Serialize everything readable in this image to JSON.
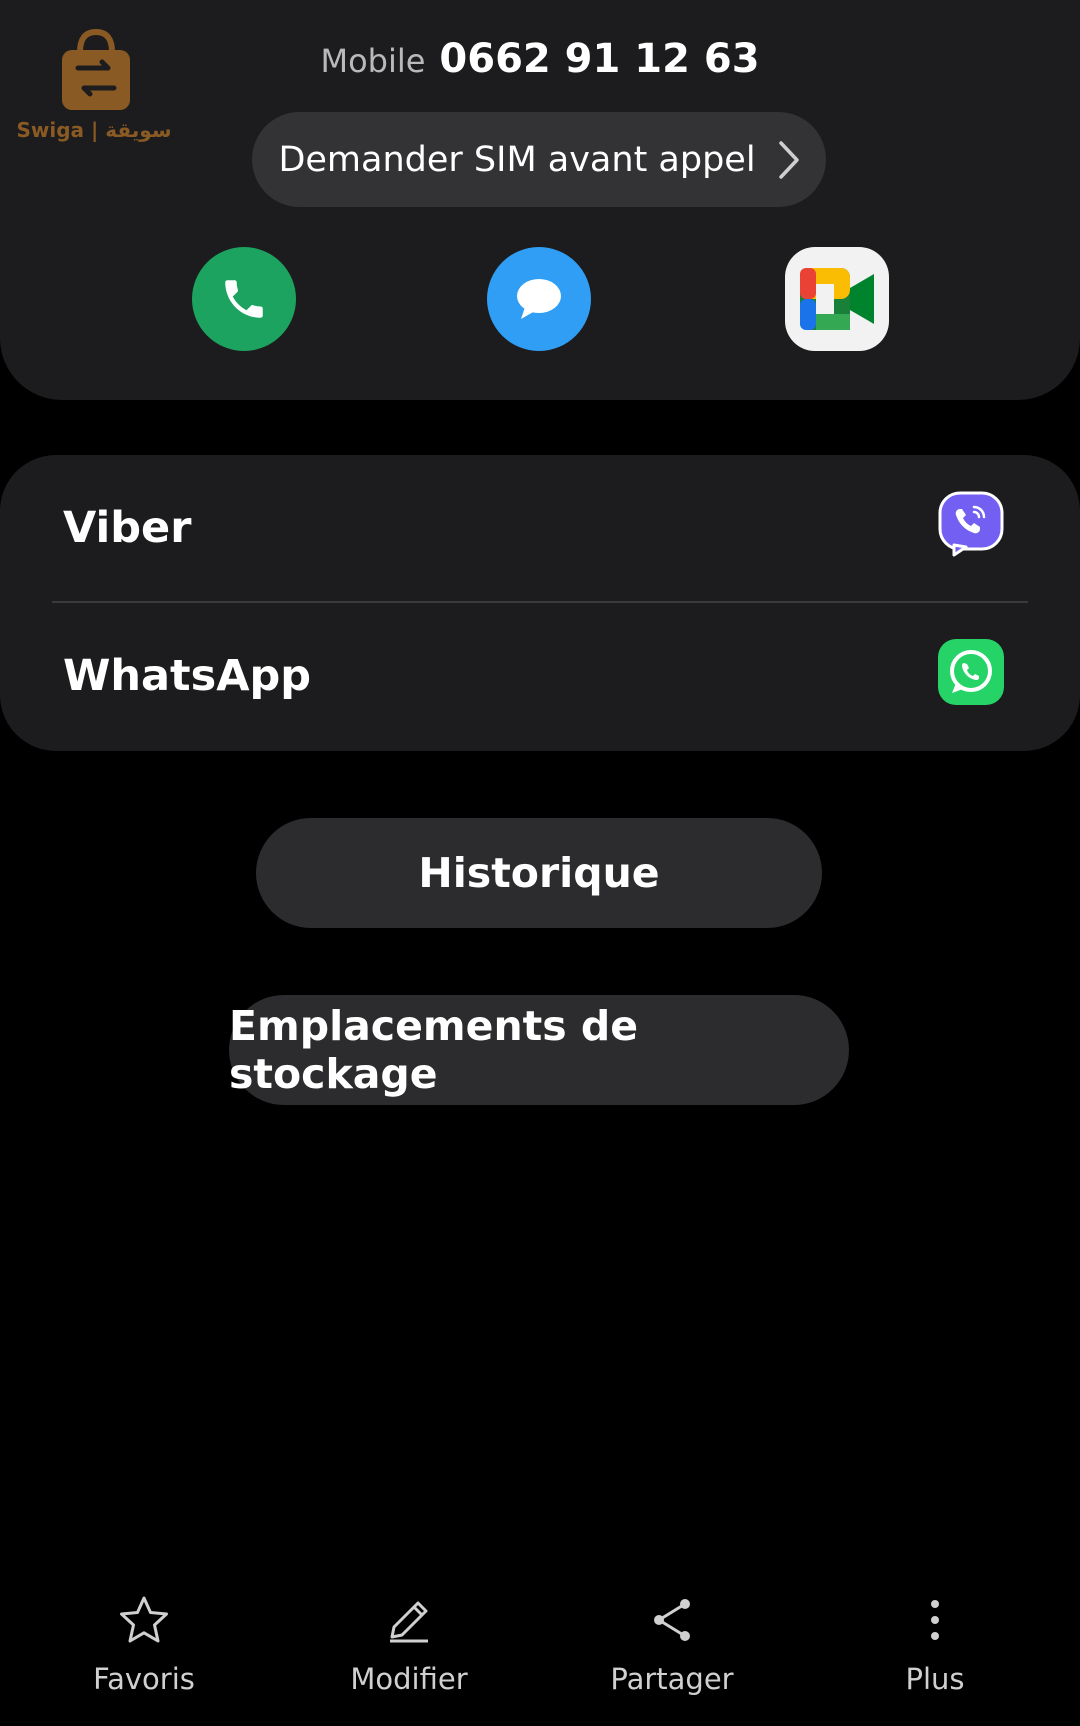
{
  "watermark": {
    "text": "Swiga | سويقة",
    "icon": "shopping-bag-icon",
    "color": "#8a5a24"
  },
  "contact": {
    "phone_label": "Mobile",
    "phone_number": "0662 91 12 63"
  },
  "sim_button": {
    "label": "Demander SIM avant appel",
    "icon": "chevron-right-icon"
  },
  "actions": {
    "call_icon": "phone-icon",
    "message_icon": "message-bubble-icon",
    "video_icon": "google-meet-icon",
    "call_color": "#1ca35f",
    "message_color": "#2f9ef4"
  },
  "apps": [
    {
      "name": "Viber",
      "icon": "viber-icon",
      "color": "#7360f2"
    },
    {
      "name": "WhatsApp",
      "icon": "whatsapp-icon",
      "color": "#25d366"
    }
  ],
  "buttons": {
    "history": "Historique",
    "storage": "Emplacements de stockage"
  },
  "bottom_nav": [
    {
      "label": "Favoris",
      "icon": "star-icon"
    },
    {
      "label": "Modifier",
      "icon": "pencil-icon"
    },
    {
      "label": "Partager",
      "icon": "share-icon"
    },
    {
      "label": "Plus",
      "icon": "more-vertical-icon"
    }
  ]
}
